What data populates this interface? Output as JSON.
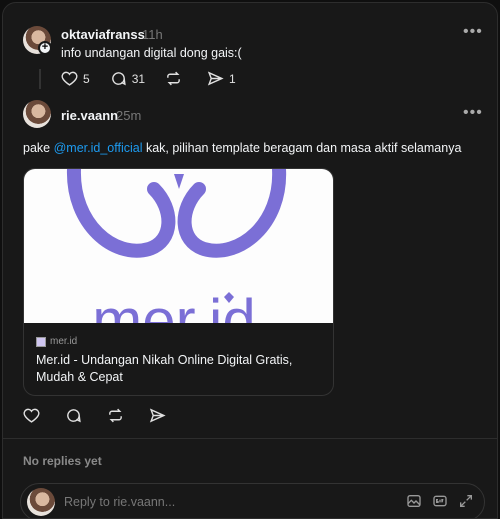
{
  "op_post": {
    "username": "oktaviafranss",
    "time": "11h",
    "text": "info undangan digital dong gais:(",
    "likes": "5",
    "comments": "31",
    "shares": "1",
    "follow_badge": "+"
  },
  "reply_post": {
    "username": "rie.vaann",
    "time": "25m",
    "text_before": "pake ",
    "mention": "@mer.id_official",
    "text_after": " kak, pilihan template beragam dan masa aktif selamanya",
    "link_card": {
      "domain": "mer.id",
      "title": "Mer.id - Undangan Nikah Online Digital Gratis, Mudah & Cepat",
      "logo_text": "mer.id"
    }
  },
  "more_glyph": "•••",
  "no_replies_text": "No replies yet",
  "reply_box": {
    "placeholder": "Reply to rie.vaann..."
  },
  "colors": {
    "background": "#181818",
    "mention": "#1d9bf0",
    "logo_purple": "#7b6fd6"
  },
  "icons": [
    "heart-icon",
    "comment-icon",
    "repost-icon",
    "share-icon",
    "more-icon",
    "image-icon",
    "gif-icon",
    "expand-icon"
  ]
}
